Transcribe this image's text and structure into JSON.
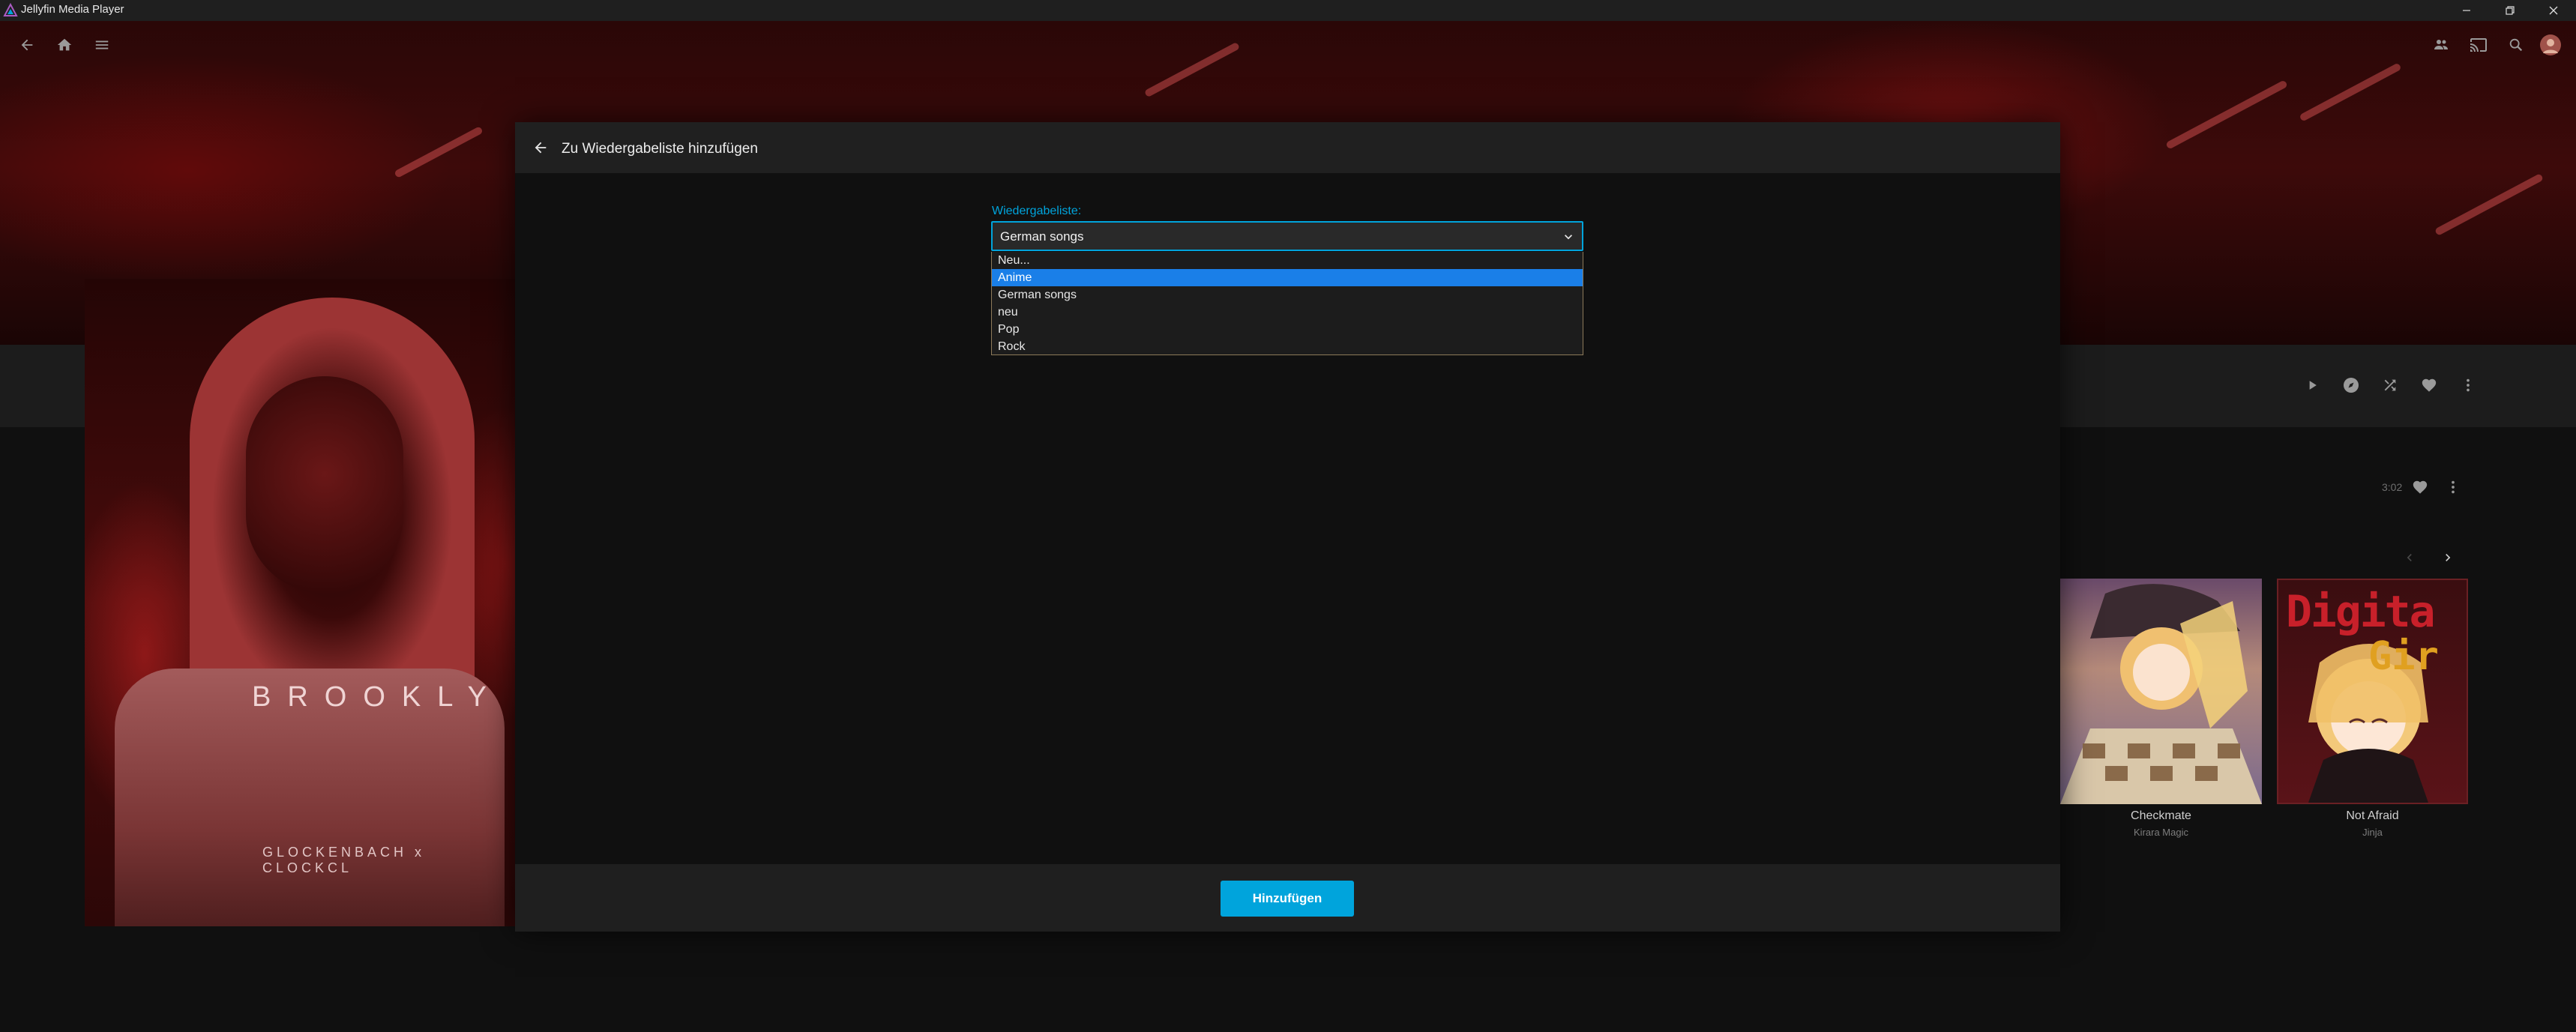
{
  "window": {
    "title": "Jellyfin Media Player"
  },
  "poster": {
    "title_text": "BROOKLY",
    "credits_text": "GLOCKENBACH x CLOCKCL"
  },
  "track": {
    "duration": "3:02"
  },
  "carousel": {
    "cards": [
      {
        "title": "Checkmate",
        "subtitle": "Kirara Magic"
      },
      {
        "title": "Not Afraid",
        "subtitle": "Jinja"
      }
    ],
    "digital_art_text": [
      "Digita",
      "Gir"
    ]
  },
  "dialog": {
    "title": "Zu Wiedergabeliste hinzufügen",
    "field_label": "Wiedergabeliste:",
    "selected_value": "German songs",
    "options": [
      {
        "label": "Neu..."
      },
      {
        "label": "Anime",
        "highlighted": true
      },
      {
        "label": "German songs"
      },
      {
        "label": "neu"
      },
      {
        "label": "Pop"
      },
      {
        "label": "Rock"
      }
    ],
    "submit_label": "Hinzufügen"
  },
  "colors": {
    "accent": "#00a4dc",
    "highlight": "#1a7fe8",
    "backdrop_red": "#3d0a0a"
  }
}
